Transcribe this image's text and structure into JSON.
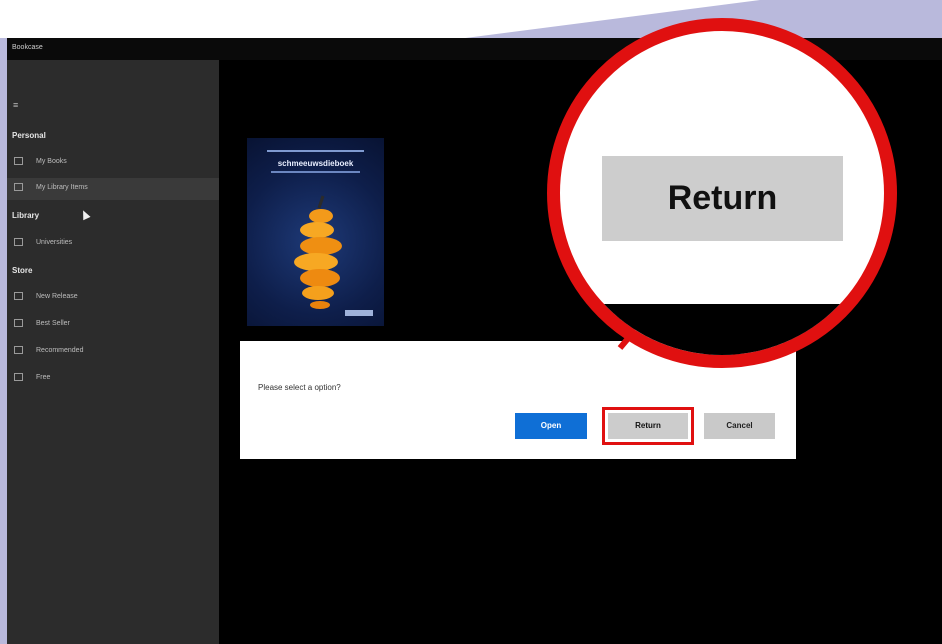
{
  "window": {
    "title": "Bookcase"
  },
  "sidebar": {
    "hamburger": "≡",
    "sections": [
      {
        "label": "Personal"
      },
      {
        "label": "Library"
      },
      {
        "label": "Store"
      }
    ],
    "items": [
      {
        "label": "My Books",
        "icon": "book-icon"
      },
      {
        "label": "My Library Items",
        "icon": "library-icon"
      },
      {
        "label": "Universities",
        "icon": "university-icon"
      },
      {
        "label": "New Release",
        "icon": "new-icon"
      },
      {
        "label": "Best Seller",
        "icon": "star-icon"
      },
      {
        "label": "Recommended",
        "icon": "thumb-icon"
      },
      {
        "label": "Free",
        "icon": "tag-icon"
      }
    ]
  },
  "book": {
    "title": "schmeeuwsdieboek"
  },
  "dialog": {
    "message": "Please select a option?",
    "open_label": "Open",
    "return_label": "Return",
    "cancel_label": "Cancel"
  },
  "magnifier": {
    "label": "Return"
  },
  "colors": {
    "highlight": "#e01010",
    "primary_button": "#0f6fd6",
    "sidebar_bg": "#2c2c2c",
    "background": "#b9b9dc"
  }
}
